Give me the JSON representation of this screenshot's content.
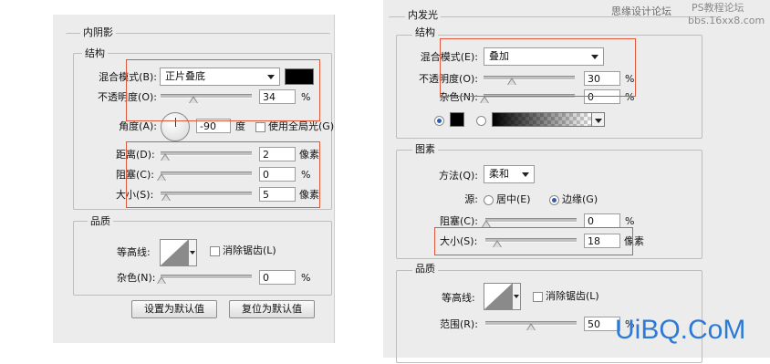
{
  "colors": {
    "panel_bg": "#ececec",
    "highlight": "#e0573a",
    "radio_selected": "#2a5db8",
    "watermark_bottom": "#2c7ad6"
  },
  "inner_shadow": {
    "title": "内阴影",
    "structure": {
      "legend": "结构",
      "blend_mode_label": "混合模式(B):",
      "blend_mode_value": "正片叠底",
      "color_swatch": "#000000",
      "opacity_label": "不透明度(O):",
      "opacity_value": "34",
      "opacity_unit": "%",
      "angle_label": "角度(A):",
      "angle_value": "-90",
      "angle_unit": "度",
      "global_light_label": "使用全局光(G)",
      "global_light_checked": false,
      "distance_label": "距离(D):",
      "distance_value": "2",
      "distance_unit": "像素",
      "choke_label": "阻塞(C):",
      "choke_value": "0",
      "choke_unit": "%",
      "size_label": "大小(S):",
      "size_value": "5",
      "size_unit": "像素"
    },
    "quality": {
      "legend": "品质",
      "contour_label": "等高线:",
      "anti_alias_label": "消除锯齿(L)",
      "anti_alias_checked": false,
      "noise_label": "杂色(N):",
      "noise_value": "0",
      "noise_unit": "%"
    },
    "buttons": {
      "make_default": "设置为默认值",
      "reset_default": "复位为默认值"
    }
  },
  "inner_glow": {
    "title": "内发光",
    "structure": {
      "legend": "结构",
      "blend_mode_label": "混合模式(E):",
      "blend_mode_value": "叠加",
      "opacity_label": "不透明度(O):",
      "opacity_value": "30",
      "opacity_unit": "%",
      "noise_label": "杂色(N):",
      "noise_value": "0",
      "noise_unit": "%",
      "color_swatch": "#000000"
    },
    "elements": {
      "legend": "图素",
      "technique_label": "方法(Q):",
      "technique_value": "柔和",
      "source_label": "源:",
      "source_center_label": "居中(E)",
      "source_edge_label": "边缘(G)",
      "source_selected": "edge",
      "choke_label": "阻塞(C):",
      "choke_value": "0",
      "choke_unit": "%",
      "size_label": "大小(S):",
      "size_value": "18",
      "size_unit": "像素"
    },
    "quality": {
      "legend": "品质",
      "contour_label": "等高线:",
      "anti_alias_label": "消除锯齿(L)",
      "anti_alias_checked": false,
      "range_label": "范围(R):",
      "range_value": "50",
      "range_unit": "%"
    }
  },
  "watermarks": {
    "top_right_line1": "思缘设计论坛",
    "top_right_line2": "PS教程论坛",
    "top_right_line3": "bbs.16xx8.com",
    "bottom_right": "UiBQ.CoM"
  }
}
